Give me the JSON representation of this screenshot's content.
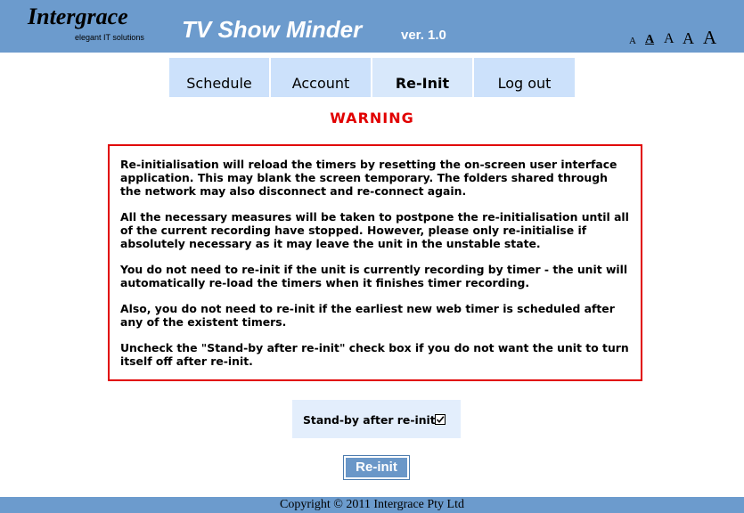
{
  "header": {
    "logo_name": "Intergrace",
    "logo_tagline": "elegant IT solutions",
    "app_title": "TV Show Minder",
    "version": "ver. 1.0",
    "font_sizes": [
      "A",
      "A",
      "A",
      "A",
      "A"
    ],
    "selected_font_size_index": 1
  },
  "nav": {
    "tabs": [
      {
        "label": "Schedule",
        "active": false
      },
      {
        "label": "Account",
        "active": false
      },
      {
        "label": "Re-Init",
        "active": true
      },
      {
        "label": "Log out",
        "active": false
      }
    ]
  },
  "main": {
    "warning_title": "WARNING",
    "paragraphs": [
      "Re-initialisation will reload the timers by resetting the on-screen user interface application. This may blank the screen temporary. The folders shared through the network may also disconnect and re-connect again.",
      "All the necessary measures will be taken to postpone the re-initialisation until all of the current recording have stopped. However, please only re-initialise if absolutely necessary as it may leave the unit in the unstable state.",
      "You do not need to re-init if the unit is currently recording by timer - the unit will automatically re-load the timers when it finishes timer recording.",
      "Also, you do not need to re-init if the earliest new web timer is scheduled after any of the existent timers.",
      "Uncheck the \"Stand-by after re-init\" check box if you do not want the unit to turn itself off after re-init."
    ],
    "standby_label": "Stand-by after re-init",
    "standby_checked": true,
    "reinit_button": "Re-init"
  },
  "footer": {
    "copyright": "Copyright © 2011 Intergrace Pty Ltd"
  },
  "colors": {
    "header_blue": "#6c9bcd",
    "tab_blue": "#cce1fb",
    "warning_red": "#e10000",
    "button_blue": "#6a97c8"
  }
}
